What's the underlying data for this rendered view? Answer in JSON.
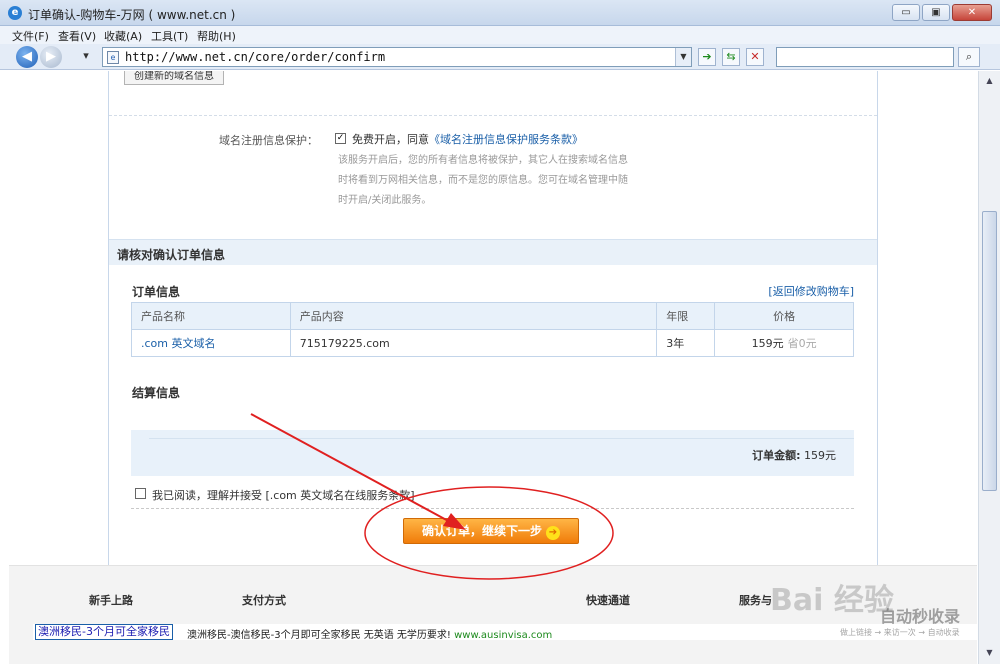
{
  "window": {
    "title": "订单确认-购物车-万网 ( www.net.cn )",
    "controls": {
      "minimize": "▭",
      "restore": "▣",
      "close": "✕"
    }
  },
  "menu": [
    "文件(F)",
    "查看(V)",
    "收藏(A)",
    "工具(T)",
    "帮助(H)"
  ],
  "address": {
    "url": "http://www.net.cn/core/order/confirm",
    "search_placeholder": ""
  },
  "page": {
    "create_domain_button": "创建新的域名信息",
    "privacy": {
      "label": "域名注册信息保护：",
      "checkbox_checked": true,
      "text_before": "免费开启，同意",
      "link": "《域名注册信息保护服务条款》",
      "desc_lines": [
        "该服务开启后，您的所有者信息将被保护，其它人在搜索域名信息",
        "时将看到万网相关信息，而不是您的原信息。您可在域名管理中随",
        "时开启/关闭此服务。"
      ]
    },
    "section_title": "请核对确认订单信息",
    "order_info_title": "订单信息",
    "return_link": "[返回修改购物车]",
    "table": {
      "headers": [
        "产品名称",
        "产品内容",
        "年限",
        "价格"
      ],
      "rows": [
        {
          "product": ".com 英文域名",
          "content": "715179225.com",
          "years": "3年",
          "price": "159元",
          "saved": "省0元"
        }
      ]
    },
    "settlement_title": "结算信息",
    "order_amount_label": "订单金额:",
    "order_amount_value": "159元",
    "agree_text": "我已阅读，理解并接受 [.com 英文域名在线服务条款]",
    "agree_checked": false,
    "confirm_button": "确认订单，继续下一步"
  },
  "footer": {
    "columns": [
      "新手上路",
      "支付方式",
      "快速通道",
      "服务与"
    ],
    "ad_link": "澳洲移民-3个月可全家移民",
    "ad_text": "澳洲移民-澳信移民-3个月即可全家移民 无英语 无学历要求! ",
    "ad_site": "www.ausinvisa.com"
  },
  "watermark": {
    "main": "Bai 经验",
    "sub": "自动秒收录",
    "tiny": "做上链接 → 来访一次 → 自动收录"
  }
}
